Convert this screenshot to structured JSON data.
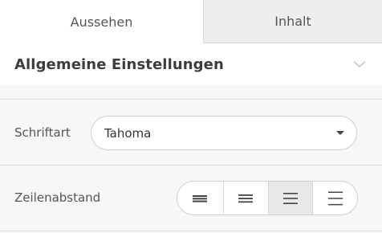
{
  "tabs": [
    {
      "label": "Aussehen",
      "active": true
    },
    {
      "label": "Inhalt",
      "active": false
    }
  ],
  "section": {
    "title": "Allgemeine Einstellungen",
    "toggle_icon": "chevron-down-icon"
  },
  "font_setting": {
    "label": "Schriftart",
    "value": "Tahoma",
    "dropdown_icon": "caret-down-icon"
  },
  "line_spacing": {
    "label": "Zeilenabstand",
    "options": [
      {
        "icon": "line-spacing-compact-icon"
      },
      {
        "icon": "line-spacing-normal-icon"
      },
      {
        "icon": "line-spacing-relaxed-icon",
        "selected": true
      },
      {
        "icon": "line-spacing-wide-icon"
      }
    ]
  },
  "colors": {
    "background": "#f7f7f7",
    "surface": "#ffffff",
    "border": "#cfcfcf",
    "selected": "#e8e8e8",
    "text": "#444444"
  }
}
